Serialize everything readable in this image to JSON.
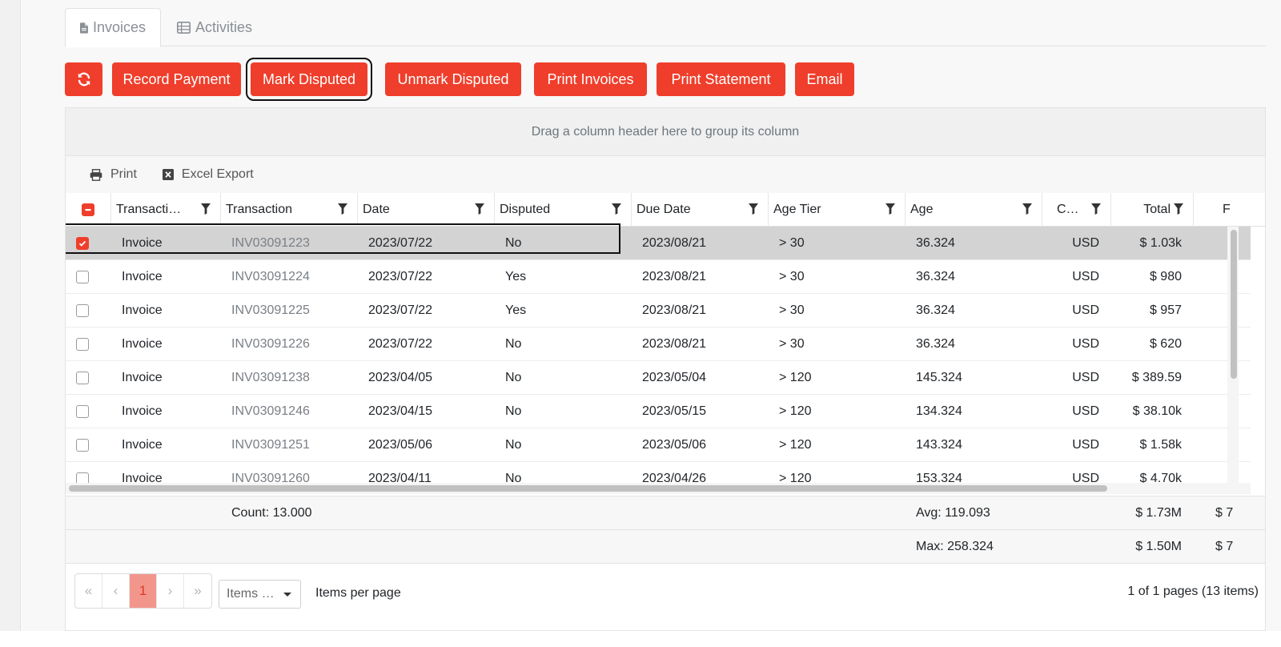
{
  "tabs": [
    {
      "label": "Invoices",
      "icon": "file-text-icon",
      "active": true
    },
    {
      "label": "Activities",
      "icon": "table-list-icon",
      "active": false
    }
  ],
  "toolbar": {
    "refresh_icon": "refresh-icon",
    "record_payment": "Record Payment",
    "mark_disputed": "Mark Disputed",
    "unmark_disputed": "Unmark Disputed",
    "print_invoices": "Print Invoices",
    "print_statement": "Print Statement",
    "email": "Email"
  },
  "grid": {
    "group_hint": "Drag a column header here to group its column",
    "tools": {
      "print": "Print",
      "excel_export": "Excel Export"
    },
    "columns": [
      "Transacti…",
      "Transaction",
      "Date",
      "Disputed",
      "Due Date",
      "Age Tier",
      "Age",
      "C…",
      "Total",
      "F"
    ],
    "rows": [
      {
        "type": "Invoice",
        "number": "INV03091223",
        "date": "2023/07/22",
        "disputed": "No",
        "due": "2023/08/21",
        "tier": "> 30",
        "age": "36.324",
        "currency": "USD",
        "total": "$ 1.03k",
        "checked": true
      },
      {
        "type": "Invoice",
        "number": "INV03091224",
        "date": "2023/07/22",
        "disputed": "Yes",
        "due": "2023/08/21",
        "tier": "> 30",
        "age": "36.324",
        "currency": "USD",
        "total": "$ 980",
        "checked": false
      },
      {
        "type": "Invoice",
        "number": "INV03091225",
        "date": "2023/07/22",
        "disputed": "Yes",
        "due": "2023/08/21",
        "tier": "> 30",
        "age": "36.324",
        "currency": "USD",
        "total": "$ 957",
        "checked": false
      },
      {
        "type": "Invoice",
        "number": "INV03091226",
        "date": "2023/07/22",
        "disputed": "No",
        "due": "2023/08/21",
        "tier": "> 30",
        "age": "36.324",
        "currency": "USD",
        "total": "$ 620",
        "checked": false
      },
      {
        "type": "Invoice",
        "number": "INV03091238",
        "date": "2023/04/05",
        "disputed": "No",
        "due": "2023/05/04",
        "tier": "> 120",
        "age": "145.324",
        "currency": "USD",
        "total": "$ 389.59",
        "checked": false
      },
      {
        "type": "Invoice",
        "number": "INV03091246",
        "date": "2023/04/15",
        "disputed": "No",
        "due": "2023/05/15",
        "tier": "> 120",
        "age": "134.324",
        "currency": "USD",
        "total": "$ 38.10k",
        "checked": false
      },
      {
        "type": "Invoice",
        "number": "INV03091251",
        "date": "2023/05/06",
        "disputed": "No",
        "due": "2023/05/06",
        "tier": "> 120",
        "age": "143.324",
        "currency": "USD",
        "total": "$ 1.58k",
        "checked": false
      },
      {
        "type": "Invoice",
        "number": "INV03091260",
        "date": "2023/04/11",
        "disputed": "No",
        "due": "2023/04/26",
        "tier": "> 120",
        "age": "153.324",
        "currency": "USD",
        "total": "$ 4.70k",
        "checked": false
      }
    ],
    "footer": {
      "count": "Count: 13.000",
      "avg": "Avg: 119.093",
      "total_sum": "$ 1.73M",
      "sum_partial": "$ 7",
      "max": "Max: 258.324",
      "total_max": "$ 1.50M",
      "max_partial": "$ 7"
    }
  },
  "pager": {
    "first": "«",
    "prev": "‹",
    "current_page": "1",
    "next": "›",
    "last": "»",
    "items_per_page_value": "Items …",
    "items_per_page_label": "Items per page",
    "info": "1 of 1 pages (13 items)"
  },
  "colors": {
    "accent": "#ef3e2b",
    "selected_row": "#d3d3d3",
    "link": "#7a7f85"
  }
}
